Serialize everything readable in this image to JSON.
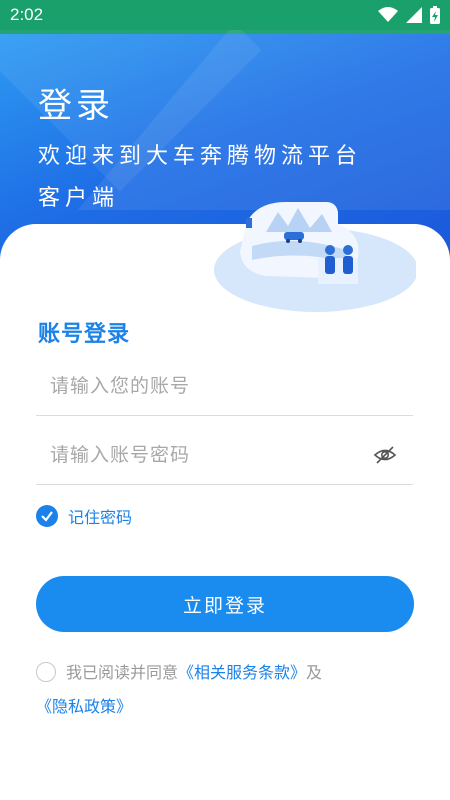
{
  "status_bar": {
    "time": "2:02",
    "icons": [
      "wifi-icon",
      "signal-icon",
      "battery-charging-icon"
    ]
  },
  "hero": {
    "title": "登录",
    "subtitle": "欢迎来到大车奔腾物流平台客户端"
  },
  "form": {
    "section_title": "账号登录",
    "account_placeholder": "请输入您的账号",
    "account_value": "",
    "password_placeholder": "请输入账号密码",
    "password_value": "",
    "remember_label": "记住密码",
    "remember_checked": true,
    "login_button": "立即登录"
  },
  "agreement": {
    "prefix": "我已阅读并同意",
    "terms_link": "《相关服务条款》",
    "connector": "及",
    "privacy_link": "《隐私政策》",
    "checked": false
  },
  "colors": {
    "primary": "#1a8cf0",
    "accent_text": "#1a82e8",
    "status_bar": "#1aa06a",
    "hero_start": "#2e9cf2",
    "hero_end": "#1a54d8"
  }
}
